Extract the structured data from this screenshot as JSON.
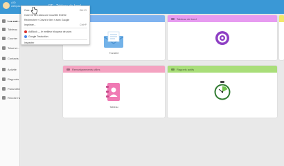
{
  "topbar": {
    "user_line1": "AID",
    "user_line2": "webpaconv...",
    "brand": "RE",
    "title": "Tableau de bord"
  },
  "sidebar": {
    "items": [
      {
        "label": "Les not..."
      },
      {
        "label": "Tableau"
      },
      {
        "label": "Courrier"
      },
      {
        "label": "Tchat et..."
      },
      {
        "label": "Contacts"
      },
      {
        "label": "Activité"
      },
      {
        "label": "Rapports"
      },
      {
        "label": "Paramètres"
      },
      {
        "label": "Rendre l'abonnemen"
      }
    ]
  },
  "dropdown": {
    "items": [
      {
        "label": "Ouvr...",
        "shortcut": "Ctrl+O"
      },
      {
        "label": "Ouvrir le lien dans une nouvelle fenêtre"
      },
      {
        "label": "Rechercher « Ouvrir le lien » avec Google"
      },
      {
        "label": "Imprimer...",
        "shortcut": "Ctrl+P"
      },
      {
        "label": "AdBlock — le meilleur bloqueur de pubs"
      },
      {
        "label": "Google Traduction"
      },
      {
        "label": "Inspecter"
      }
    ]
  },
  "cards": [
    {
      "title": "",
      "caption": "Transfert",
      "color": "#7fb3f0",
      "icon": "envelope-icon"
    },
    {
      "title": "Tableau de bord",
      "caption": "",
      "color": "#e79bf0",
      "icon": "target-icon"
    },
    {
      "title": "Renseignements utiles",
      "caption": "Tableau",
      "color": "#f4a3c1",
      "icon": "contacts-book-icon"
    },
    {
      "title": "Rappels actifs",
      "caption": "",
      "color": "#a9de79",
      "icon": "stopwatch-icon"
    },
    {
      "title": "",
      "caption": "",
      "color": "#f3e86b",
      "icon": ""
    }
  ],
  "colors": {
    "topbar": "#3a98d6",
    "sidebar": "#fafafa",
    "page": "#e9e9e9"
  }
}
